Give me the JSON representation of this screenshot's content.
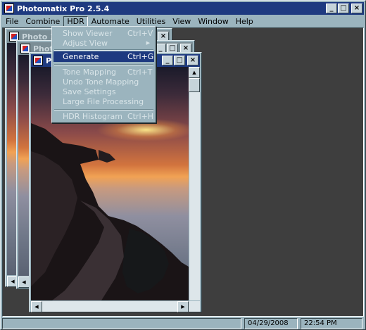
{
  "app": {
    "title": "Photomatix Pro 2.5.4",
    "min_symbol": "_",
    "max_symbol": "□",
    "close_symbol": "×"
  },
  "menubar": {
    "items": [
      "File",
      "Combine",
      "HDR",
      "Automate",
      "Utilities",
      "View",
      "Window",
      "Help"
    ],
    "active": "HDR"
  },
  "child_windows": [
    {
      "title": "Photo 153",
      "state": "inactive"
    },
    {
      "title": "Photo",
      "state": "inactive"
    },
    {
      "title": "Ph",
      "state": "active"
    }
  ],
  "hdr_menu": {
    "items": [
      {
        "label": "Show Viewer",
        "shortcut": "Ctrl+V",
        "enabled": false
      },
      {
        "label": "Adjust View",
        "shortcut": "",
        "enabled": false,
        "submenu": true,
        "arrow_symbol": "▶"
      },
      {
        "label": "Generate",
        "shortcut": "Ctrl+G",
        "enabled": true,
        "highlighted": true
      },
      {
        "label": "Tone Mapping",
        "shortcut": "Ctrl+T",
        "enabled": false
      },
      {
        "label": "Undo Tone Mapping",
        "shortcut": "",
        "enabled": false
      },
      {
        "label": "Save Settings",
        "shortcut": "",
        "enabled": false
      },
      {
        "label": "Large File Processing",
        "shortcut": "",
        "enabled": false
      },
      {
        "label": "HDR Histogram",
        "shortcut": "Ctrl+H",
        "enabled": false
      }
    ]
  },
  "statusbar": {
    "date": "04/29/2008",
    "time": "22:54 PM"
  },
  "scroll_symbols": {
    "up": "▲",
    "down": "▼",
    "left": "◀",
    "right": "▶"
  },
  "colors": {
    "titlebar_active": "#1e3a80",
    "titlebar_inactive": "#7b8e96",
    "chrome": "#9bb4be",
    "mdi_background": "#3e3e3e"
  }
}
